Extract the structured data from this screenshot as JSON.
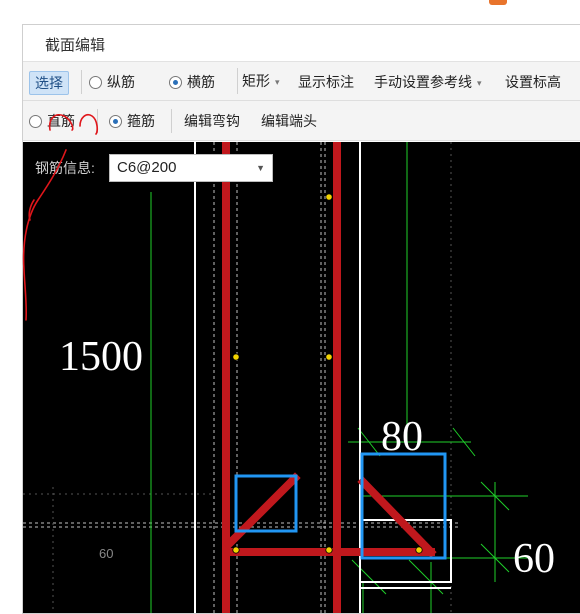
{
  "window": {
    "title": "截面编辑"
  },
  "toolbar1": {
    "select": "选择",
    "rebar_long": "纵筋",
    "rebar_trans": "横筋",
    "shape": "矩形",
    "show_label": "显示标注",
    "manual_ref": "手动设置参考线",
    "set_elevation": "设置标高"
  },
  "toolbar2": {
    "straight": "直筋",
    "stirrup": "箍筋",
    "edit_hook": "编辑弯钩",
    "edit_end": "编辑端头"
  },
  "rebar_info": {
    "label": "钢筋信息:",
    "value": "C6@200"
  },
  "canvas": {
    "dim_1500": "1500",
    "dim_80": "80",
    "dim_60_large": "60",
    "dim_60_small": "60"
  },
  "colors": {
    "rebar": "#c0181d",
    "guide": "#1fcf2a",
    "outline": "#ffffff",
    "selection": "#2196f3",
    "point": "#f2d300",
    "annotation": "#e0161b"
  }
}
